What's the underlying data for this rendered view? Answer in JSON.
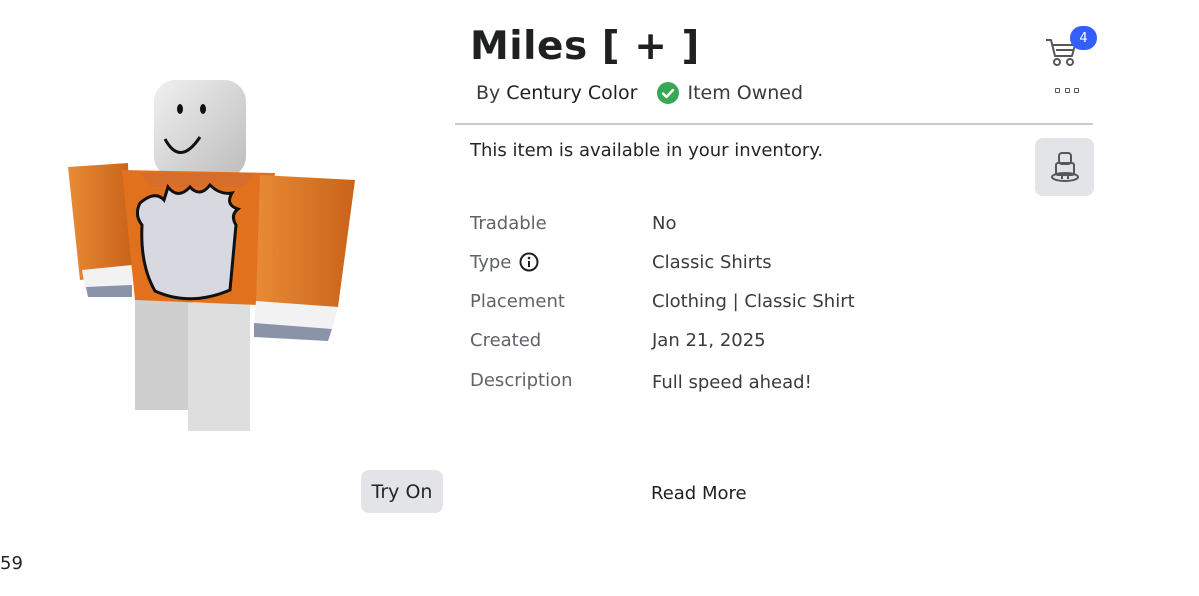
{
  "item": {
    "title": "Miles [ + ]",
    "by_prefix": "By",
    "creator": "Century Color",
    "owned_label": "Item Owned",
    "availability": "This item is available in your inventory."
  },
  "cart": {
    "count": "4"
  },
  "details": {
    "tradable": {
      "label": "Tradable",
      "value": "No"
    },
    "type": {
      "label": "Type",
      "value": "Classic Shirts"
    },
    "placement": {
      "label": "Placement",
      "value": "Clothing | Classic Shirt"
    },
    "created": {
      "label": "Created",
      "value": "Jan 21, 2025"
    },
    "description": {
      "label": "Description",
      "value": "Full speed ahead!"
    }
  },
  "actions": {
    "try_on": "Try On",
    "read_more": "Read More"
  },
  "corner_number": "59",
  "colors": {
    "accent_blue": "#335fff",
    "owned_green": "#39a852",
    "shirt_orange": "#e2711d",
    "button_gray": "#e3e4e7"
  },
  "icons": [
    "cart-icon",
    "more-icon",
    "check-icon",
    "info-icon",
    "avatar-icon"
  ]
}
